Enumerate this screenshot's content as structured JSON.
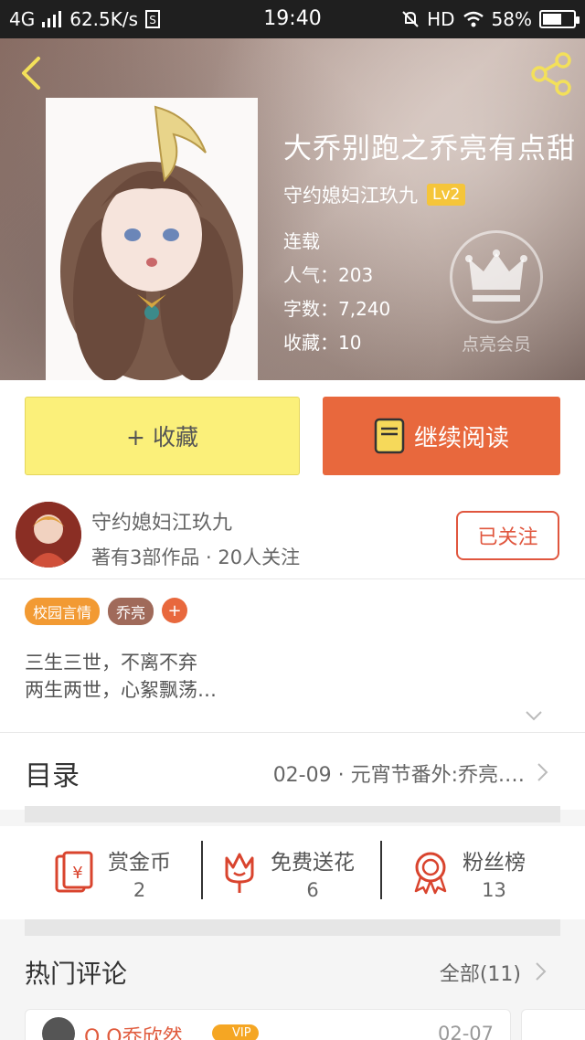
{
  "status_bar": {
    "network": "4G",
    "speed": "62.5K/s",
    "time": "19:40",
    "hd": "HD",
    "battery": "58%"
  },
  "book": {
    "title": "大乔别跑之乔亮有点甜",
    "author": "守约媳妇江玖九",
    "level": "Lv2",
    "status": "连载",
    "popularity": "人气：203",
    "word_count": "字数：7,240",
    "favorites": "收藏：10",
    "vip_label": "点亮会员"
  },
  "actions": {
    "favorite_label": "+ 收藏",
    "read_label": "继续阅读"
  },
  "author_card": {
    "name": "守约媳妇江玖九",
    "subtitle": "著有3部作品 · 20人关注",
    "follow_label": "已关注"
  },
  "tags": [
    "校园言情",
    "乔亮",
    "+"
  ],
  "description": {
    "line1": "三生三世，不离不弃",
    "line2": "两生两世，心絮飘荡…"
  },
  "catalog": {
    "label": "目录",
    "latest": "02-09 · 元宵节番外:乔亮.…"
  },
  "rewards": [
    {
      "label": "赏金币",
      "value": "2"
    },
    {
      "label": "免费送花",
      "value": "6"
    },
    {
      "label": "粉丝榜",
      "value": "13"
    }
  ],
  "comments": {
    "title": "热门评论",
    "all_label": "全部(11)",
    "first": {
      "user": "Q Q乔欣然",
      "badge": "VIP",
      "date": "02-07"
    }
  },
  "colors": {
    "accent_orange": "#e8683d",
    "favorite_yellow": "#fbf07a",
    "level_gold": "#f5c53a"
  }
}
